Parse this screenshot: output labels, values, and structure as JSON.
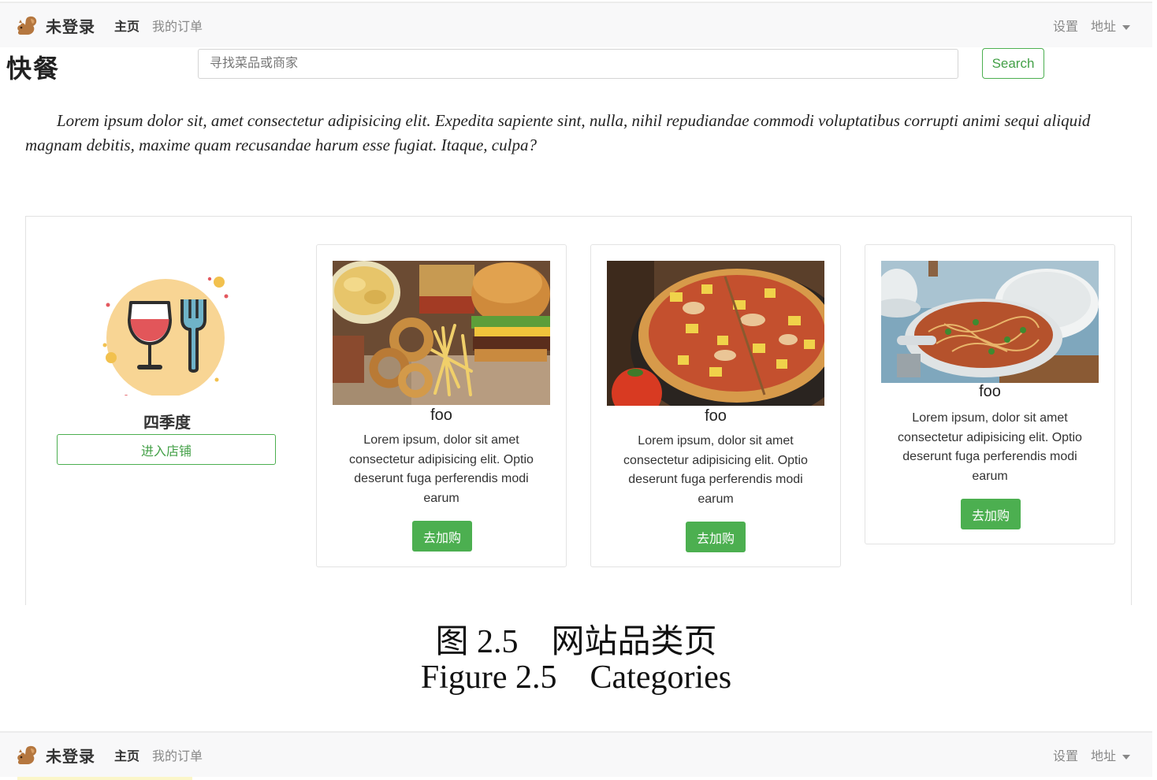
{
  "navbar": {
    "brand": "未登录",
    "home": "主页",
    "orders": "我的订单",
    "settings": "设置",
    "address": "地址"
  },
  "header": {
    "title": "快餐",
    "search_placeholder": "寻找菜品或商家",
    "search_button": "Search"
  },
  "intro_text": "Lorem ipsum dolor sit, amet consectetur adipisicing elit. Expedita sapiente sint, nulla, nihil repudiandae commodi voluptatibus corrupti animi sequi aliquid magnam debitis, maxime quam recusandae harum esse fugiat. Itaque, culpa?",
  "shop": {
    "name": "四季度",
    "enter_button": "进入店铺"
  },
  "products": [
    {
      "title": "foo",
      "description": "Lorem ipsum, dolor sit amet consectetur adipisicing elit. Optio deserunt fuga perferendis modi earum",
      "button": "去加购",
      "image": "fast-food-image"
    },
    {
      "title": "foo",
      "description": "Lorem ipsum, dolor sit amet consectetur adipisicing elit. Optio deserunt fuga perferendis modi earum",
      "button": "去加购",
      "image": "pizza-image"
    },
    {
      "title": "foo",
      "description": "Lorem ipsum, dolor sit amet consectetur adipisicing elit. Optio deserunt fuga perferendis modi earum",
      "button": "去加购",
      "image": "pasta-pan-image"
    }
  ],
  "caption": {
    "cn": "图 2.5    网站品类页",
    "en": "Figure 2.5    Categories"
  },
  "colors": {
    "accent_green": "#4caf50",
    "navbar_bg": "#f8f8f9"
  }
}
